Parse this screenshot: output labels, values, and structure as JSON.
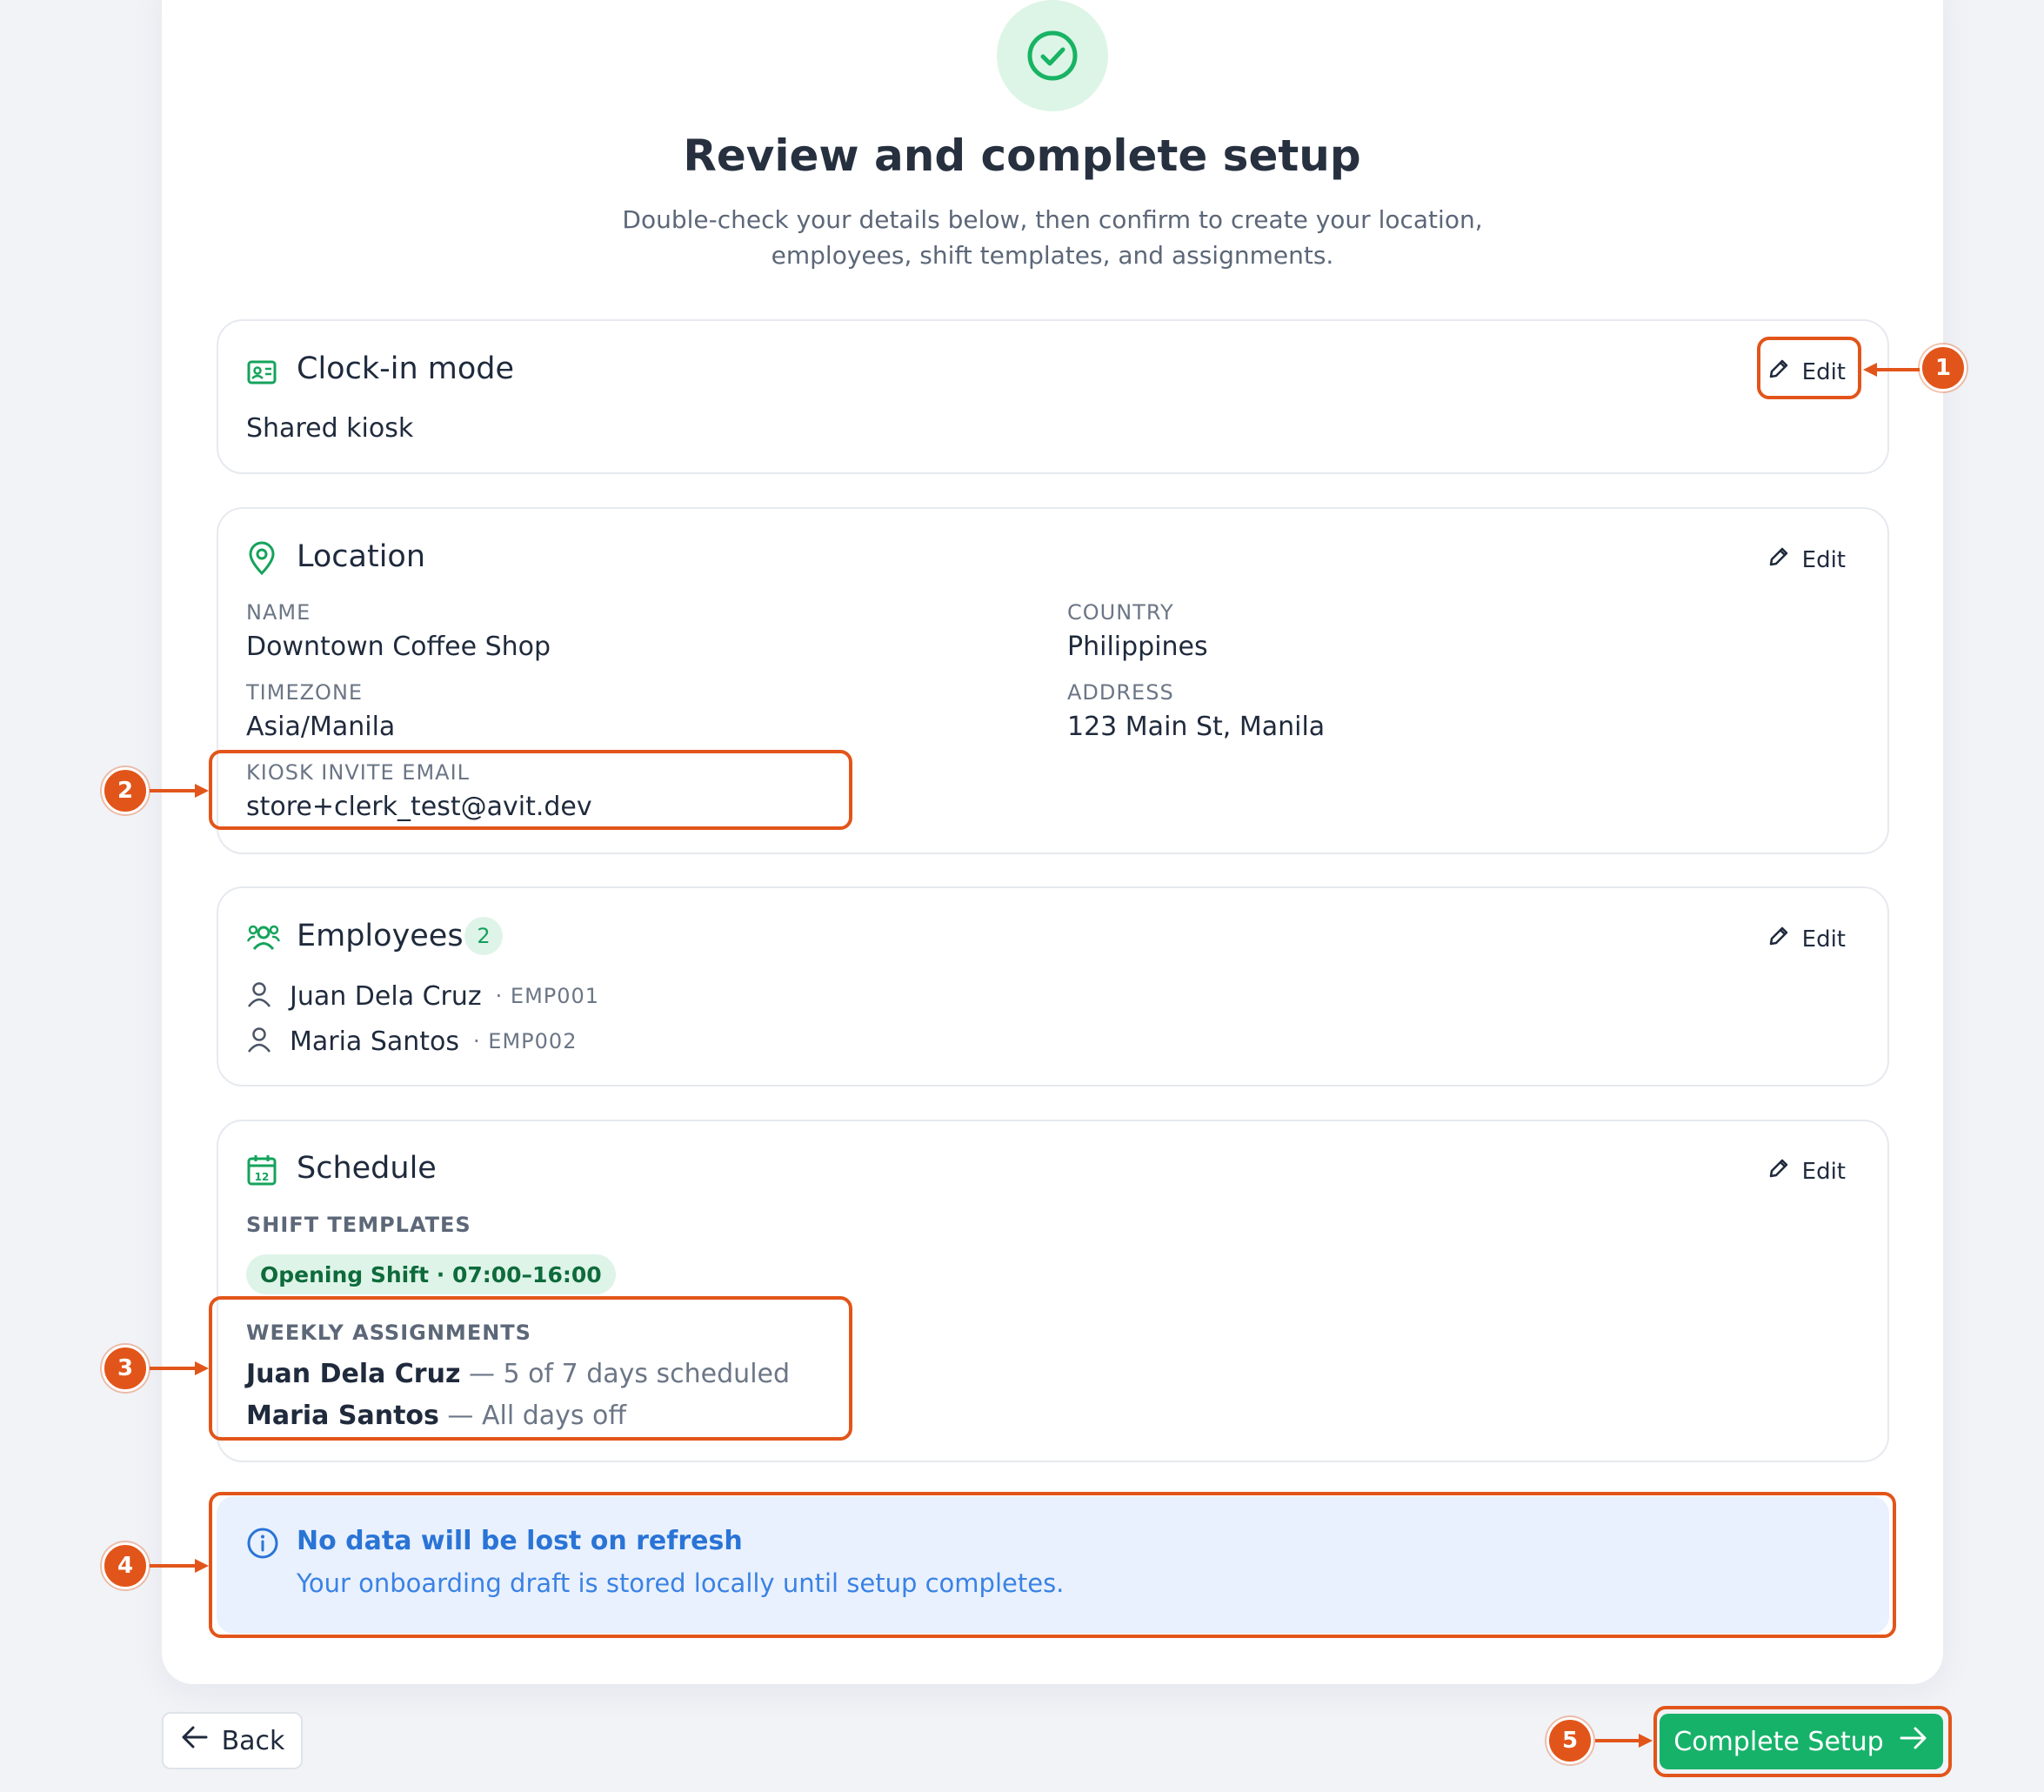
{
  "header": {
    "title": "Review and complete setup",
    "subtitle_line1": "Double-check your details below, then confirm to create your location,",
    "subtitle_line2": "employees, shift templates, and assignments."
  },
  "edit_label": "Edit",
  "clock_in": {
    "title": "Clock-in mode",
    "value": "Shared kiosk"
  },
  "location": {
    "title": "Location",
    "name_label": "NAME",
    "name_value": "Downtown Coffee Shop",
    "country_label": "COUNTRY",
    "country_value": "Philippines",
    "timezone_label": "TIMEZONE",
    "timezone_value": "Asia/Manila",
    "address_label": "ADDRESS",
    "address_value": "123 Main St, Manila",
    "kiosk_email_label": "KIOSK INVITE EMAIL",
    "kiosk_email_value": "store+clerk_test@avit.dev"
  },
  "employees": {
    "title": "Employees",
    "count": "2",
    "items": [
      {
        "name": "Juan Dela Cruz",
        "code": "· EMP001"
      },
      {
        "name": "Maria Santos",
        "code": "· EMP002"
      }
    ]
  },
  "schedule": {
    "title": "Schedule",
    "shift_templates_label": "SHIFT TEMPLATES",
    "shift_template": "Opening Shift · 07:00–16:00",
    "weekly_label": "WEEKLY ASSIGNMENTS",
    "assignments": [
      {
        "name": "Juan Dela Cruz",
        "desc": " — 5 of 7 days scheduled"
      },
      {
        "name": "Maria Santos",
        "desc": " — All days off"
      }
    ]
  },
  "info": {
    "title": "No data will be lost on refresh",
    "description": "Your onboarding draft is stored locally until setup completes."
  },
  "footer": {
    "back_label": "Back",
    "complete_label": "Complete Setup"
  },
  "annotations": [
    "1",
    "2",
    "3",
    "4",
    "5"
  ],
  "colors": {
    "accent_green": "#17b26a",
    "annotation_orange": "#e2551a",
    "info_blue": "#2a74d6"
  }
}
